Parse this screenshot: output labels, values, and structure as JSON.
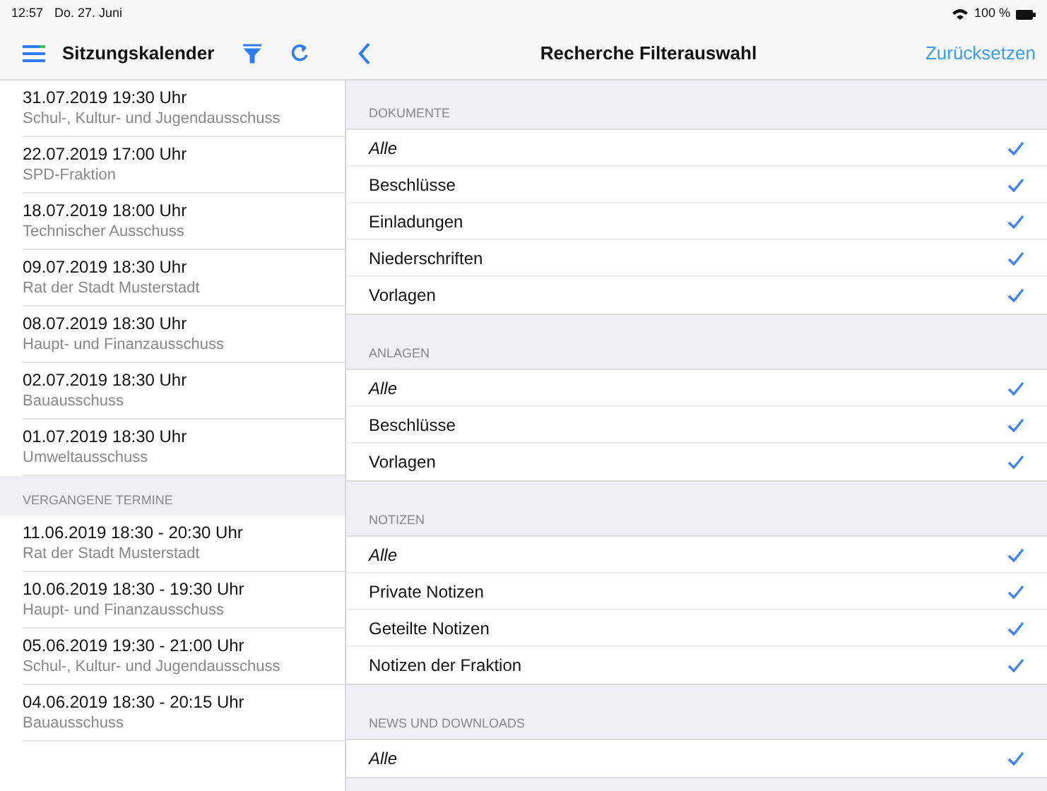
{
  "status_bar": {
    "time": "12:57",
    "date": "Do. 27. Juni",
    "battery": "100 %"
  },
  "sidebar": {
    "title": "Sitzungskalender",
    "sections": [
      {
        "items": [
          {
            "date": "31.07.2019 19:30 Uhr",
            "title": "Schul-, Kultur- und Jugendausschuss"
          },
          {
            "date": "22.07.2019 17:00 Uhr",
            "title": "SPD-Fraktion"
          },
          {
            "date": "18.07.2019 18:00 Uhr",
            "title": "Technischer Ausschuss"
          },
          {
            "date": "09.07.2019 18:30 Uhr",
            "title": "Rat der Stadt Musterstadt"
          },
          {
            "date": "08.07.2019 18:30 Uhr",
            "title": "Haupt- und Finanzausschuss"
          },
          {
            "date": "02.07.2019 18:30 Uhr",
            "title": "Bauausschuss"
          },
          {
            "date": "01.07.2019 18:30 Uhr",
            "title": "Umweltausschuss"
          }
        ]
      },
      {
        "header": "VERGANGENE TERMINE",
        "items": [
          {
            "date": "11.06.2019 18:30 -  20:30 Uhr",
            "title": "Rat der Stadt Musterstadt"
          },
          {
            "date": "10.06.2019 18:30 -  19:30 Uhr",
            "title": "Haupt- und Finanzausschuss"
          },
          {
            "date": "05.06.2019 19:30 -  21:00 Uhr",
            "title": "Schul-, Kultur- und Jugendausschuss"
          },
          {
            "date": "04.06.2019 18:30 -  20:15 Uhr",
            "title": "Bauausschuss"
          }
        ]
      }
    ]
  },
  "detail": {
    "title": "Recherche Filterauswahl",
    "reset_button": "Zurücksetzen",
    "sections": [
      {
        "header": "DOKUMENTE",
        "items": [
          {
            "label": "Alle",
            "kind": "all",
            "checked": true
          },
          {
            "label": "Beschlüsse",
            "kind": "option",
            "checked": true
          },
          {
            "label": "Einladungen",
            "kind": "option",
            "checked": true
          },
          {
            "label": "Niederschriften",
            "kind": "option",
            "checked": true
          },
          {
            "label": "Vorlagen",
            "kind": "option",
            "checked": true
          }
        ]
      },
      {
        "header": "ANLAGEN",
        "items": [
          {
            "label": "Alle",
            "kind": "all",
            "checked": true
          },
          {
            "label": "Beschlüsse",
            "kind": "option",
            "checked": true
          },
          {
            "label": "Vorlagen",
            "kind": "option",
            "checked": true
          }
        ]
      },
      {
        "header": "NOTIZEN",
        "items": [
          {
            "label": "Alle",
            "kind": "all",
            "checked": true
          },
          {
            "label": "Private Notizen",
            "kind": "option",
            "checked": true
          },
          {
            "label": "Geteilte Notizen",
            "kind": "option",
            "checked": true
          },
          {
            "label": "Notizen der Fraktion",
            "kind": "option",
            "checked": true
          }
        ]
      },
      {
        "header": "NEWS UND DOWNLOADS",
        "items": [
          {
            "label": "Alle",
            "kind": "all",
            "checked": true
          }
        ]
      }
    ]
  }
}
